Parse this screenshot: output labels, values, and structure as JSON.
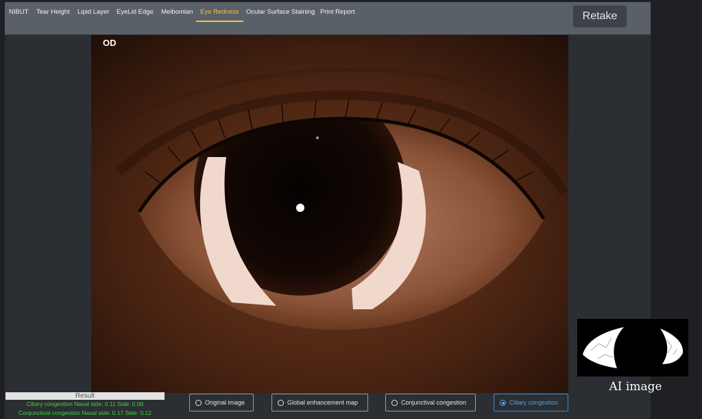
{
  "tabs": [
    {
      "label": "NIBUT"
    },
    {
      "label": "Tear Height"
    },
    {
      "label": "Lipid Layer"
    },
    {
      "label": "EyeLid Edge"
    },
    {
      "label": "Meibomian"
    },
    {
      "label": "Eye Redness",
      "active": true
    },
    {
      "label": "Ocular Surface Staining"
    },
    {
      "label": "Print Report"
    }
  ],
  "retake_label": "Retake",
  "eye_label": "OD",
  "ai_image_label": "AI image",
  "result": {
    "title": "Result",
    "ciliary": "Ciliary congestion Nasal side: 0.11 Side: 0.08",
    "conjunctival": "Conjunctival congestion Nasal side: 0.17 Side: 0.12"
  },
  "view_options": [
    {
      "label": "Original image"
    },
    {
      "label": "Global enhancement map"
    },
    {
      "label": "Conjunctival congestion"
    },
    {
      "label": "Ciliary congestion",
      "selected": true
    }
  ],
  "colors": {
    "active_tab": "#f5c242",
    "selected_option": "#4fa2ea",
    "result_text": "#3fd63f"
  }
}
